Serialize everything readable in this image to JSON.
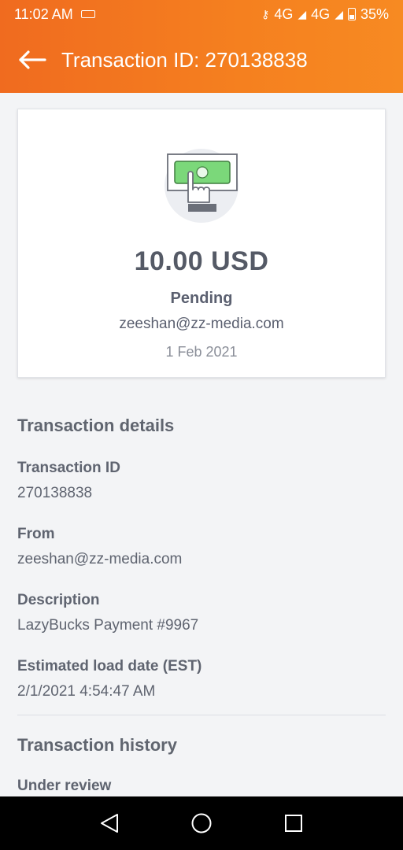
{
  "status_bar": {
    "time": "11:02 AM",
    "network1": "4G",
    "network2": "4G",
    "battery": "35%"
  },
  "header": {
    "title": "Transaction ID: 270138838"
  },
  "summary": {
    "amount": "10.00 USD",
    "status": "Pending",
    "email": "zeeshan@zz-media.com",
    "date": "1 Feb 2021"
  },
  "details": {
    "section_title": "Transaction details",
    "fields": [
      {
        "label": "Transaction ID",
        "value": "270138838"
      },
      {
        "label": "From",
        "value": "zeeshan@zz-media.com"
      },
      {
        "label": "Description",
        "value": "LazyBucks Payment #9967"
      },
      {
        "label": "Estimated load date (EST)",
        "value": "2/1/2021 4:54:47 AM"
      }
    ]
  },
  "history": {
    "section_title": "Transaction history",
    "first_item": "Under review"
  },
  "colors": {
    "header_orange": "#f5801f",
    "money_green": "#7bd87a"
  }
}
